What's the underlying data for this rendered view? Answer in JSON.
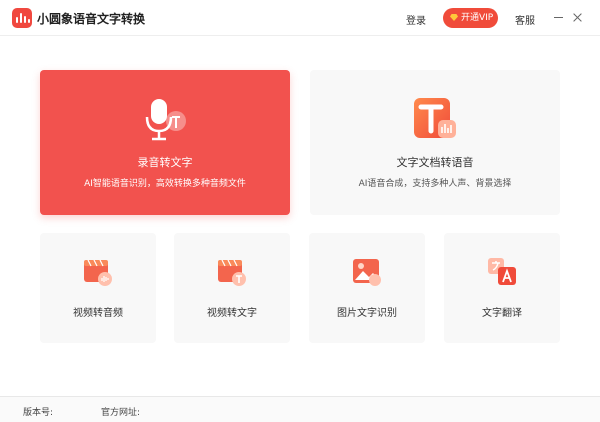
{
  "titlebar": {
    "app_title": "小圆象语音文字转换",
    "login_label": "登录",
    "vip_label": "开通VIP",
    "service_label": "客服",
    "minimize_icon": "minimize-icon",
    "close_icon": "close-icon"
  },
  "features": {
    "record_to_text": {
      "title": "录音转文字",
      "subtitle": "AI智能语音识别，高效转换多种音频文件",
      "icon": "microphone-icon",
      "color": "#f2524e"
    },
    "text_to_speech": {
      "title": "文字文档转语音",
      "subtitle": "AI语音合成，支持多种人声、背景选择",
      "icon": "text-document-icon"
    },
    "video_to_audio": {
      "title": "视频转音频",
      "icon": "video-audio-icon"
    },
    "video_to_text": {
      "title": "视频转文字",
      "icon": "video-text-icon"
    },
    "image_ocr": {
      "title": "图片文字识别",
      "icon": "image-icon"
    },
    "translate": {
      "title": "文字翻译",
      "icon": "translate-icon"
    }
  },
  "footer": {
    "version_label": "版本号:",
    "website_label": "官方网址:"
  },
  "colors": {
    "accent": "#f04b3a",
    "card_background": "#f8f8f8",
    "vip_gem": "#ffc83a"
  }
}
